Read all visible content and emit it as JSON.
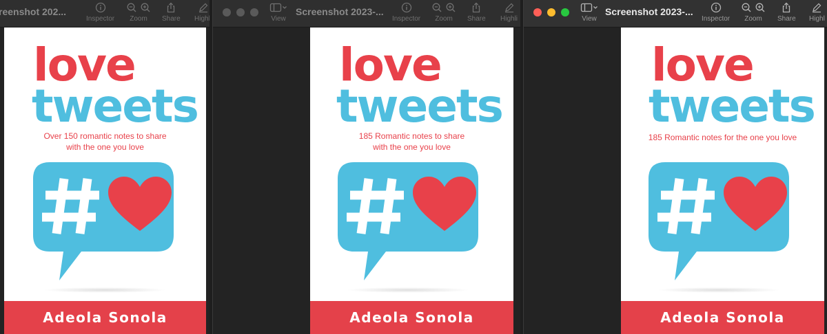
{
  "windows": [
    {
      "title": "reenshot 202...",
      "tools": {
        "inspector": "Inspector",
        "zoom": "Zoom",
        "share": "Share",
        "highlight": "Highli"
      },
      "book": {
        "title_line1": "love",
        "title_line2": "tweets",
        "subtitle_line1": "Over 150 romantic notes to share",
        "subtitle_line2": "with the one you love",
        "author": "Adeola Sonola"
      }
    },
    {
      "title": "Screenshot 2023-...",
      "tools": {
        "view": "View",
        "inspector": "Inspector",
        "zoom": "Zoom",
        "share": "Share",
        "highlight": "Highli"
      },
      "book": {
        "title_line1": "love",
        "title_line2": "tweets",
        "subtitle_line1": "185 Romantic notes to share",
        "subtitle_line2": "with the one you love",
        "author": "Adeola Sonola"
      }
    },
    {
      "title": "Screenshot 2023-...",
      "tools": {
        "view": "View",
        "inspector": "Inspector",
        "zoom": "Zoom",
        "share": "Share",
        "highlight": "Highl"
      },
      "book": {
        "title_line1": "love",
        "title_line2": "tweets",
        "subtitle_line1": "185 Romantic notes for the one you love",
        "author": "Adeola Sonola"
      }
    }
  ],
  "colors": {
    "love_red": "#e8414a",
    "tweets_blue": "#4fbedf",
    "author_band": "#e4414a",
    "heart_red": "#e8414a",
    "bubble_blue": "#4fbedf"
  },
  "icons": [
    "traffic-lights",
    "sidebar-icon",
    "info-icon",
    "zoom-out-icon",
    "zoom-in-icon",
    "share-icon",
    "highlight-pen-icon",
    "hash-icon",
    "heart-icon"
  ]
}
